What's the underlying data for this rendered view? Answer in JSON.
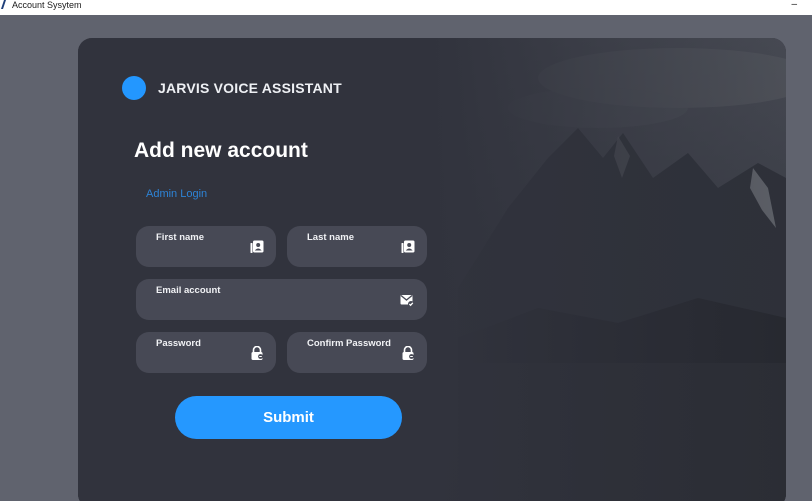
{
  "window": {
    "title": "Account Sysytem",
    "minimize_glyph": "–"
  },
  "brand": {
    "name": "JARVIS VOICE ASSISTANT",
    "accent": "#2397ff"
  },
  "form": {
    "heading": "Add new account",
    "admin_link": "Admin Login",
    "fields": {
      "first_name": {
        "label": "First name",
        "value": "",
        "icon": "contact-card-icon"
      },
      "last_name": {
        "label": "Last name",
        "value": "",
        "icon": "contact-card-icon"
      },
      "email": {
        "label": "Email account",
        "value": "",
        "icon": "mail-check-icon"
      },
      "password": {
        "label": "Password",
        "value": "",
        "icon": "lock-icon"
      },
      "confirm_password": {
        "label": "Confirm Password",
        "value": "",
        "icon": "lock-icon"
      }
    },
    "submit_label": "Submit"
  },
  "colors": {
    "card_bg": "#31333d",
    "field_bg": "#474955",
    "link": "#2d83d6",
    "button": "#2598ff"
  }
}
